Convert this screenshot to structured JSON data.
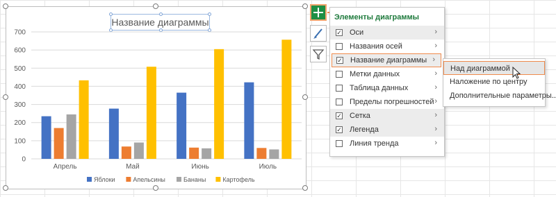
{
  "chart_data": {
    "type": "bar",
    "title": "Название диаграммы",
    "categories": [
      "Апрель",
      "Май",
      "Июнь",
      "Июль"
    ],
    "series": [
      {
        "name": "Яблоки",
        "values": [
          235,
          277,
          365,
          422
        ],
        "color": "#4472c4"
      },
      {
        "name": "Апельсины",
        "values": [
          170,
          68,
          62,
          60
        ],
        "color": "#ed7d31"
      },
      {
        "name": "Бананы",
        "values": [
          245,
          90,
          58,
          52
        ],
        "color": "#a5a5a5"
      },
      {
        "name": "Картофель",
        "values": [
          433,
          508,
          605,
          657
        ],
        "color": "#ffc000"
      }
    ],
    "ylim": [
      0,
      700
    ],
    "yticks": [
      "0",
      "100",
      "200",
      "300",
      "400",
      "500",
      "600",
      "700"
    ],
    "grid": true,
    "legend_position": "bottom"
  },
  "side_buttons": {
    "elements": "plus-icon",
    "styles": "brush-icon",
    "filters": "funnel-icon"
  },
  "menu": {
    "header": "Элементы диаграммы",
    "items": [
      {
        "label": "Оси",
        "checked": true,
        "highlight": true
      },
      {
        "label": "Названия осей",
        "checked": false,
        "highlight": false
      },
      {
        "label": "Название диаграммы",
        "checked": true,
        "highlight": true
      },
      {
        "label": "Метки данных",
        "checked": false,
        "highlight": false
      },
      {
        "label": "Таблица данных",
        "checked": false,
        "highlight": false
      },
      {
        "label": "Пределы погрешностей",
        "checked": false,
        "highlight": false
      },
      {
        "label": "Сетка",
        "checked": true,
        "highlight": true
      },
      {
        "label": "Легенда",
        "checked": true,
        "highlight": true
      },
      {
        "label": "Линия тренда",
        "checked": false,
        "highlight": false
      }
    ]
  },
  "submenu": {
    "items": [
      {
        "label": "Над диаграммой"
      },
      {
        "label": "Наложение по центру"
      },
      {
        "label": "Дополнительные параметры..."
      }
    ]
  },
  "colors": {
    "accent_green": "#1e8f45",
    "highlight_orange": "#f08a4b"
  }
}
